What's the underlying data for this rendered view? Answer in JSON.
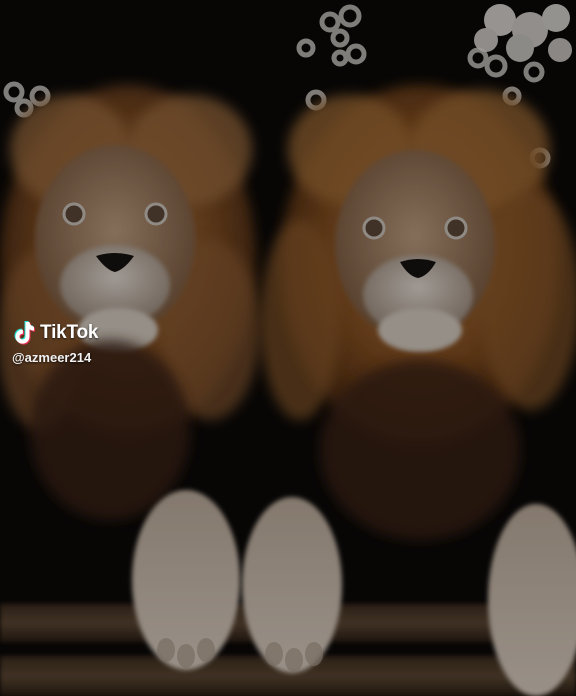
{
  "watermark": {
    "brand": "TikTok",
    "handle": "@azmeer214",
    "logo_icon": "tiktok-note-icon"
  },
  "scene": {
    "subject": "two-lion-plush-toys",
    "colors": {
      "background": "#0b0908",
      "fur_light": "#b08c6a",
      "fur_mid": "#8a5a2e",
      "fur_dark": "#4a2a14",
      "muzzle": "#d8cfc6",
      "paw": "#cdbfb2"
    }
  }
}
